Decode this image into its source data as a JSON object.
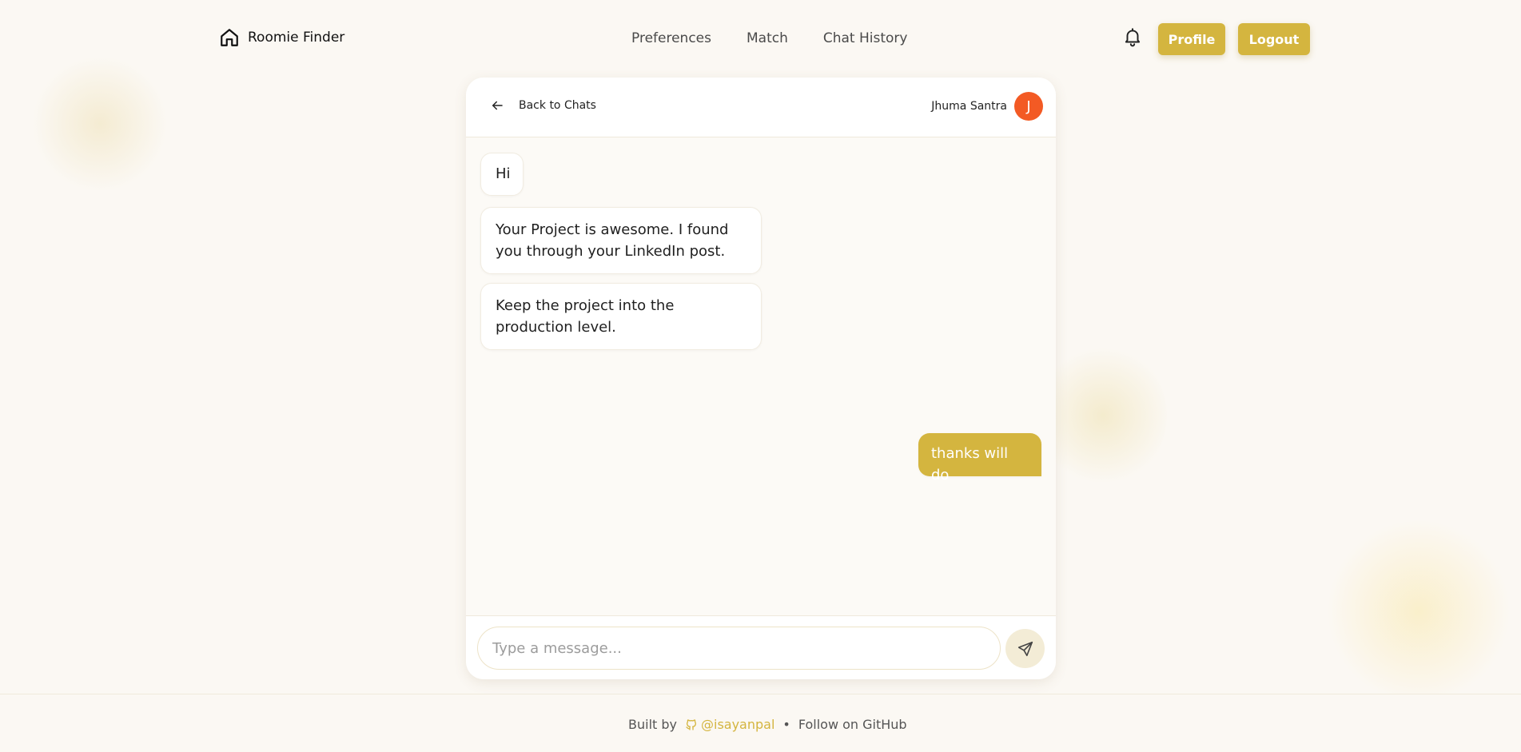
{
  "nav": {
    "brand": "Roomie Finder",
    "links": [
      "Preferences",
      "Match",
      "Chat History"
    ],
    "profile_label": "Profile",
    "logout_label": "Logout",
    "icons": {
      "brand": "home-icon",
      "notifications": "bell-icon"
    }
  },
  "chat": {
    "back_label": "Back to Chats",
    "contact_name": "Jhuma Santra",
    "contact_initial": "J",
    "avatar_color": "#f35a24",
    "messages": [
      {
        "from": "them",
        "text": "Hi"
      },
      {
        "from": "them",
        "text": "Your Project is awesome. I found you through your LinkedIn post."
      },
      {
        "from": "them",
        "text": "Keep the project into the production level."
      },
      {
        "from": "me",
        "text": "thanks will do"
      }
    ],
    "input_placeholder": "Type a message...",
    "input_value": ""
  },
  "footer": {
    "built_by": "Built by",
    "handle": "@isayanpal",
    "separator": "•",
    "follow": "Follow on GitHub"
  },
  "colors": {
    "accent": "#d4b53f",
    "background": "#fbf8f3"
  }
}
